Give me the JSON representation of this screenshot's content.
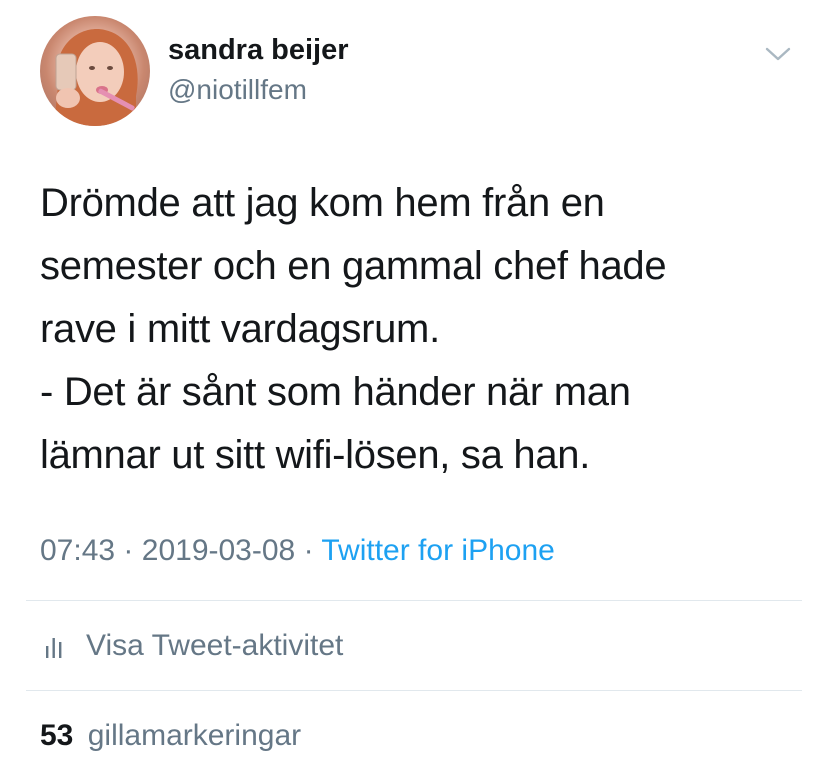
{
  "author": {
    "display_name": "sandra beijer",
    "handle": "@niotillfem"
  },
  "tweet": {
    "lines": [
      "Drömde att jag kom hem från en",
      "semester och en gammal chef hade",
      "rave i mitt vardagsrum.",
      "- Det är sånt som händer när man",
      "lämnar ut sitt wifi-lösen, sa han."
    ],
    "time": "07:43",
    "date": "2019-03-08",
    "separator": "·",
    "source": "Twitter for iPhone"
  },
  "activity": {
    "label": "Visa Tweet-aktivitet",
    "icon": "bar-chart-icon"
  },
  "likes": {
    "count": "53",
    "label": "gillamarkeringar"
  },
  "colors": {
    "text_primary": "#14171a",
    "text_secondary": "#657786",
    "link": "#1da1f2",
    "divider": "#e1e8ed"
  },
  "icons": {
    "menu": "chevron-down-icon"
  }
}
